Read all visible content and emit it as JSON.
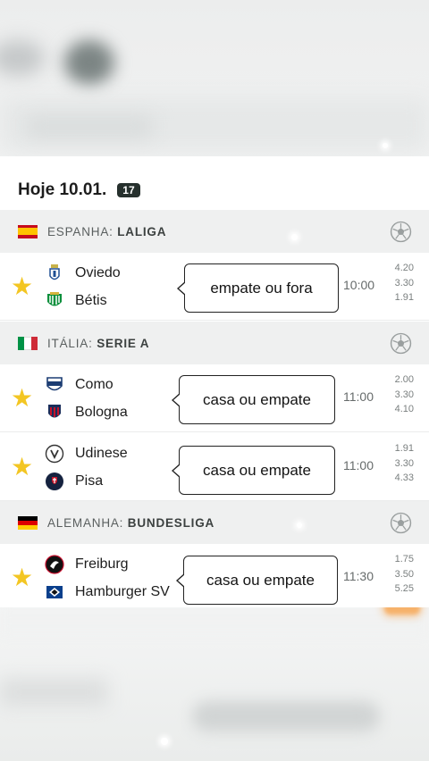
{
  "header": {
    "date": "Hoje 10.01.",
    "match_count": "17"
  },
  "leagues": [
    {
      "country": "ESPANHA:",
      "name": "LALIGA",
      "flag_colors": [
        "#c60b1e",
        "#ffc400",
        "#c60b1e"
      ],
      "matches": [
        {
          "home": "Oviedo",
          "away": "Bétis",
          "time": "10:00",
          "odds": [
            "4.20",
            "3.30",
            "1.91"
          ],
          "bubble": "empate ou fora"
        }
      ]
    },
    {
      "country": "ITÁLIA:",
      "name": "SERIE A",
      "flag_colors": [
        "#009246",
        "#ffffff",
        "#ce2b37"
      ],
      "matches": [
        {
          "home": "Como",
          "away": "Bologna",
          "time": "11:00",
          "odds": [
            "2.00",
            "3.30",
            "4.10"
          ],
          "bubble": "casa ou empate"
        },
        {
          "home": "Udinese",
          "away": "Pisa",
          "time": "11:00",
          "odds": [
            "1.91",
            "3.30",
            "4.33"
          ],
          "bubble": "casa ou empate"
        }
      ]
    },
    {
      "country": "ALEMANHA:",
      "name": "BUNDESLIGA",
      "flag_colors": [
        "#000000",
        "#dd0000",
        "#ffce00"
      ],
      "matches": [
        {
          "home": "Freiburg",
          "away": "Hamburger SV",
          "time": "11:30",
          "odds": [
            "1.75",
            "3.50",
            "5.25"
          ],
          "bubble": "casa ou empate"
        }
      ]
    }
  ],
  "icons": {
    "favorite": "star-icon",
    "sport": "soccer-ball-icon"
  },
  "colors": {
    "star": "#f3c623",
    "league_bg": "#eff0f0",
    "badge_bg": "#26302d"
  }
}
